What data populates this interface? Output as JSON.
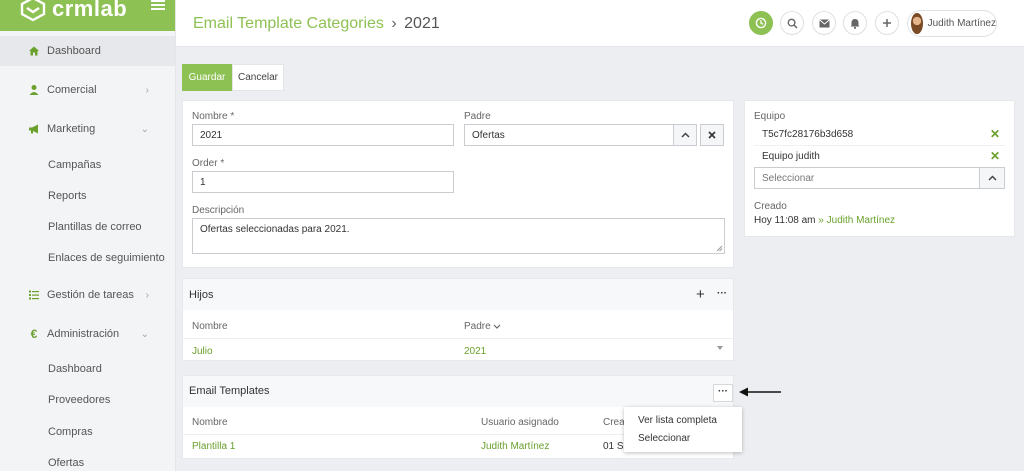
{
  "brand": {
    "name": "crmlab"
  },
  "sidebar": {
    "items": [
      {
        "label": "Dashboard",
        "icon": "home-icon"
      },
      {
        "label": "Comercial",
        "icon": "user-icon"
      },
      {
        "label": "Marketing",
        "icon": "megaphone-icon",
        "sub": [
          "Campañas",
          "Reports",
          "Plantillas de correo",
          "Enlaces de seguimiento"
        ]
      },
      {
        "label": "Gestión de tareas",
        "icon": "tasks-icon"
      },
      {
        "label": "Administración",
        "icon": "euro-icon",
        "sub": [
          "Dashboard",
          "Proveedores",
          "Compras",
          "Ofertas"
        ]
      }
    ]
  },
  "header": {
    "title": "Email Template Categories",
    "separator": "›",
    "current": "2021",
    "user": "Judith Martínez"
  },
  "toolbar": {
    "save_label": "Guardar",
    "cancel_label": "Cancelar"
  },
  "form": {
    "nombre_label": "Nombre *",
    "nombre_value": "2021",
    "padre_label": "Padre",
    "padre_value": "Ofertas",
    "order_label": "Order *",
    "order_value": "1",
    "descripcion_label": "Descripción",
    "descripcion_value": "Ofertas seleccionadas para 2021."
  },
  "side_panel": {
    "equipo_label": "Equipo",
    "teams": [
      "T5c7fc28176b3d658",
      "Equipo judith"
    ],
    "select_placeholder": "Seleccionar",
    "creado_label": "Creado",
    "creado_time": "Hoy 11:08 am",
    "creado_sep": "»",
    "creado_user": "Judith Martínez"
  },
  "hijos": {
    "title": "Hijos",
    "headers": [
      "Nombre",
      "Padre"
    ],
    "rows": [
      {
        "nombre": "Julio",
        "padre": "2021"
      }
    ]
  },
  "email_templates": {
    "title": "Email Templates",
    "headers": [
      "Nombre",
      "Usuario asignado",
      "Creado"
    ],
    "rows": [
      {
        "nombre": "Plantilla 1",
        "usuario": "Judith Martínez",
        "creado": "01 Se"
      }
    ],
    "header_visible_fragment": "Crea",
    "menu": [
      "Ver lista completa",
      "Seleccionar"
    ]
  },
  "colors": {
    "accent": "#8ec153",
    "link": "#6aa02c"
  }
}
